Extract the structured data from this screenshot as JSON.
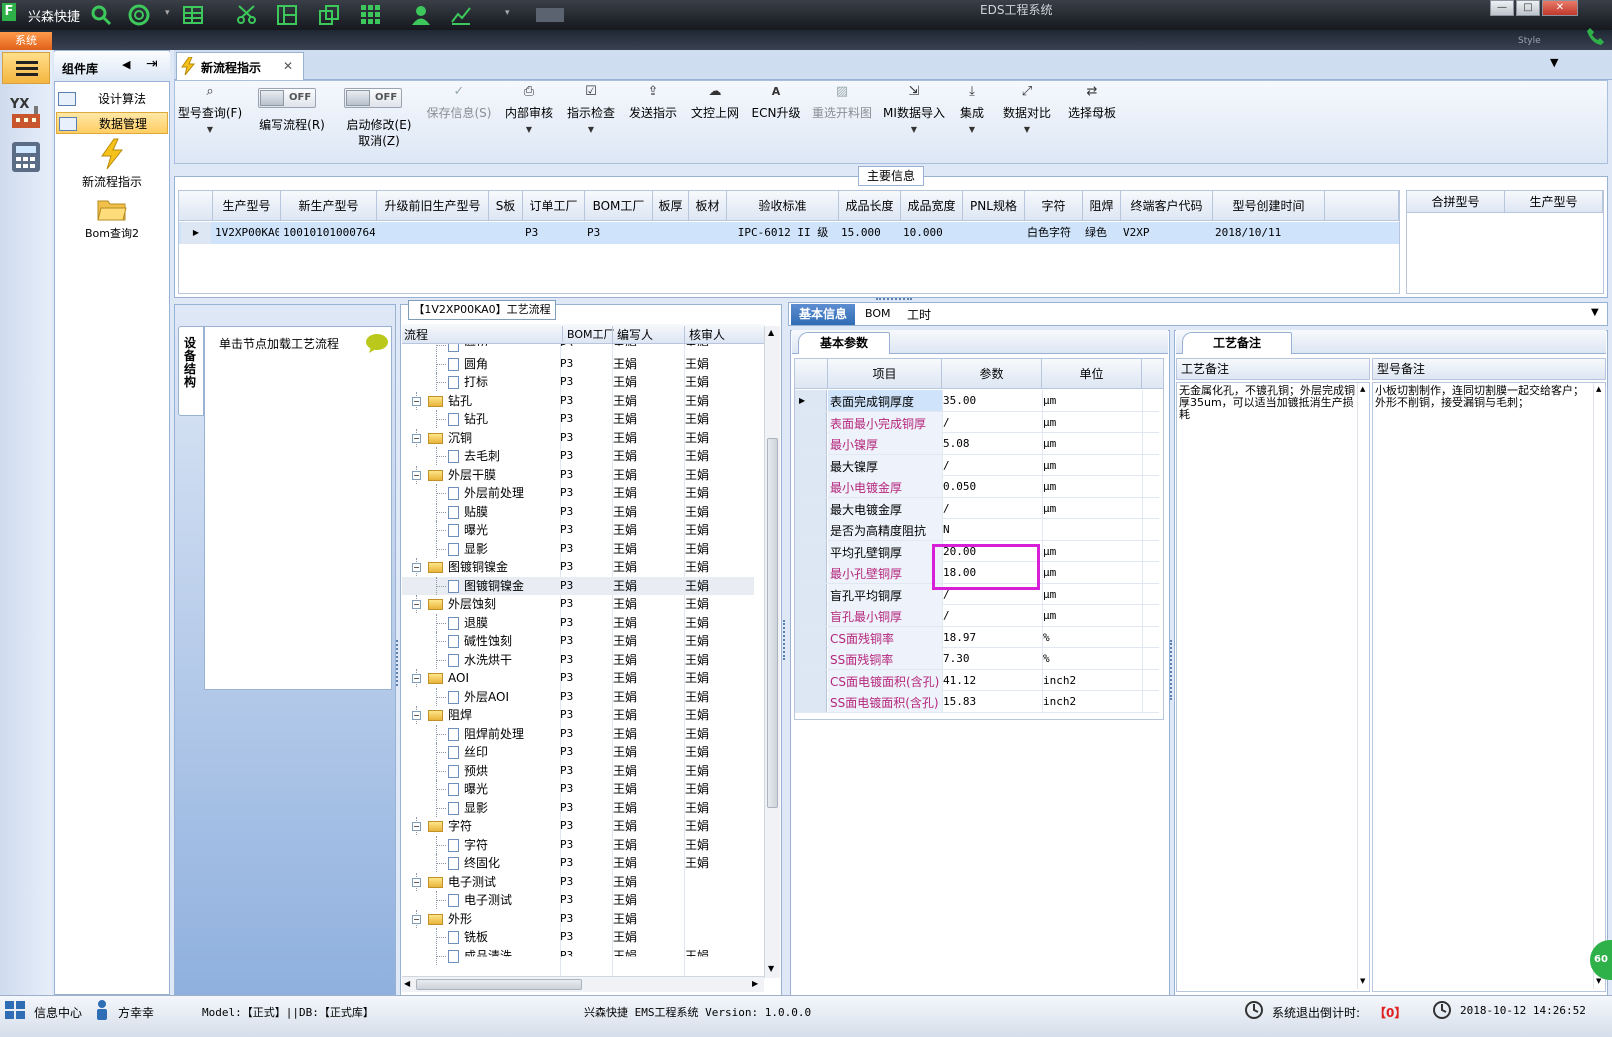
{
  "titlebar": {
    "app_name": "兴森快捷",
    "window_title": "EDS工程系统",
    "icons": [
      "search-icon",
      "lifebuoy-icon",
      "grid-icon",
      "scissors-icon",
      "layout-icon",
      "copy-icon",
      "apps-icon",
      "user-icon",
      "chart-icon"
    ]
  },
  "system_tab": "系统",
  "style_label": "Style",
  "component_panel": {
    "title": "组件库",
    "items": [
      {
        "label": "设计算法"
      },
      {
        "label": "数据管理"
      }
    ],
    "big_items": [
      {
        "label": "新流程指示",
        "icon": "lightning-icon"
      },
      {
        "label": "Bom查询2",
        "icon": "folder-icon"
      }
    ]
  },
  "document_tab": {
    "title": "新流程指示"
  },
  "ribbon": {
    "buttons": [
      {
        "label": "型号查询(F)",
        "icon": "search-icon",
        "dropdown": true
      },
      {
        "label": "保存信息(S)",
        "icon": "check-icon",
        "disabled": true
      },
      {
        "label": "内部审核",
        "icon": "print-icon",
        "dropdown": true
      },
      {
        "label": "指示检查",
        "icon": "checkbox-icon",
        "dropdown": true
      },
      {
        "label": "发送指示",
        "icon": "upload-icon"
      },
      {
        "label": "文控上网",
        "icon": "cloud-icon"
      },
      {
        "label": "ECN升级",
        "icon": "ecn-icon"
      },
      {
        "label": "重选开料图",
        "icon": "image-icon",
        "disabled": true
      },
      {
        "label": "MI数据导入",
        "icon": "import-icon",
        "dropdown": true
      },
      {
        "label": "集成",
        "icon": "download-icon",
        "dropdown": true
      },
      {
        "label": "数据对比",
        "icon": "compare-icon",
        "dropdown": true
      },
      {
        "label": "选择母板",
        "icon": "shuffle-icon"
      }
    ],
    "toggles": [
      {
        "label": "编写流程(R)",
        "state": "OFF"
      },
      {
        "label": "启动修改(E)",
        "sub_label": "取消(Z)",
        "state": "OFF"
      }
    ]
  },
  "main_info": {
    "title": "主要信息",
    "columns": [
      "生产型号",
      "新生产型号",
      "升级前旧生产型号",
      "S板",
      "订单工厂",
      "BOM工厂",
      "板厚",
      "板材",
      "验收标准",
      "成品长度",
      "成品宽度",
      "PNL规格",
      "字符",
      "阻焊",
      "终端客户代码",
      "型号创建时间"
    ],
    "row": [
      "1V2XP00KA0",
      "10010101000764",
      "",
      "",
      "P3",
      "P3",
      "",
      "",
      "IPC-6012 II 级",
      "15.000",
      "10.000",
      "",
      "白色字符",
      "绿色",
      "V2XP",
      "2018/10/11"
    ],
    "merge_columns": [
      "合拼型号",
      "生产型号"
    ]
  },
  "device_tab": "设备结构",
  "node_hint": "单击节点加载工艺流程",
  "process_panel": {
    "title": "【1V2XP00KA0】工艺流程",
    "columns": [
      "流程",
      "BOM工厂",
      "编写人",
      "核审人"
    ],
    "rows": [
      {
        "level": 2,
        "name": "磨边",
        "bom": "P3",
        "writer": "王娟",
        "checker": "王娟",
        "partial": true
      },
      {
        "level": 2,
        "name": "圆角",
        "bom": "P3",
        "writer": "王娟",
        "checker": "王娟"
      },
      {
        "level": 2,
        "name": "打标",
        "bom": "P3",
        "writer": "王娟",
        "checker": "王娟"
      },
      {
        "level": 1,
        "name": "钻孔",
        "bom": "P3",
        "writer": "王娟",
        "checker": "王娟"
      },
      {
        "level": 2,
        "name": "钻孔",
        "bom": "P3",
        "writer": "王娟",
        "checker": "王娟"
      },
      {
        "level": 1,
        "name": "沉铜",
        "bom": "P3",
        "writer": "王娟",
        "checker": "王娟"
      },
      {
        "level": 2,
        "name": "去毛刺",
        "bom": "P3",
        "writer": "王娟",
        "checker": "王娟"
      },
      {
        "level": 1,
        "name": "外层干膜",
        "bom": "P3",
        "writer": "王娟",
        "checker": "王娟"
      },
      {
        "level": 2,
        "name": "外层前处理",
        "bom": "P3",
        "writer": "王娟",
        "checker": "王娟"
      },
      {
        "level": 2,
        "name": "贴膜",
        "bom": "P3",
        "writer": "王娟",
        "checker": "王娟"
      },
      {
        "level": 2,
        "name": "曝光",
        "bom": "P3",
        "writer": "王娟",
        "checker": "王娟"
      },
      {
        "level": 2,
        "name": "显影",
        "bom": "P3",
        "writer": "王娟",
        "checker": "王娟"
      },
      {
        "level": 1,
        "name": "图镀铜镍金",
        "bom": "P3",
        "writer": "王娟",
        "checker": "王娟"
      },
      {
        "level": 2,
        "name": "图镀铜镍金",
        "bom": "P3",
        "writer": "王娟",
        "checker": "王娟",
        "selected": true
      },
      {
        "level": 1,
        "name": "外层蚀刻",
        "bom": "P3",
        "writer": "王娟",
        "checker": "王娟"
      },
      {
        "level": 2,
        "name": "退膜",
        "bom": "P3",
        "writer": "王娟",
        "checker": "王娟"
      },
      {
        "level": 2,
        "name": "碱性蚀刻",
        "bom": "P3",
        "writer": "王娟",
        "checker": "王娟"
      },
      {
        "level": 2,
        "name": "水洗烘干",
        "bom": "P3",
        "writer": "王娟",
        "checker": "王娟"
      },
      {
        "level": 1,
        "name": "AOI",
        "bom": "P3",
        "writer": "王娟",
        "checker": "王娟"
      },
      {
        "level": 2,
        "name": "外层AOI",
        "bom": "P3",
        "writer": "王娟",
        "checker": "王娟"
      },
      {
        "level": 1,
        "name": "阻焊",
        "bom": "P3",
        "writer": "王娟",
        "checker": "王娟"
      },
      {
        "level": 2,
        "name": "阻焊前处理",
        "bom": "P3",
        "writer": "王娟",
        "checker": "王娟"
      },
      {
        "level": 2,
        "name": "丝印",
        "bom": "P3",
        "writer": "王娟",
        "checker": "王娟"
      },
      {
        "level": 2,
        "name": "预烘",
        "bom": "P3",
        "writer": "王娟",
        "checker": "王娟"
      },
      {
        "level": 2,
        "name": "曝光",
        "bom": "P3",
        "writer": "王娟",
        "checker": "王娟"
      },
      {
        "level": 2,
        "name": "显影",
        "bom": "P3",
        "writer": "王娟",
        "checker": "王娟"
      },
      {
        "level": 1,
        "name": "字符",
        "bom": "P3",
        "writer": "王娟",
        "checker": "王娟"
      },
      {
        "level": 2,
        "name": "字符",
        "bom": "P3",
        "writer": "王娟",
        "checker": "王娟"
      },
      {
        "level": 2,
        "name": "终固化",
        "bom": "P3",
        "writer": "王娟",
        "checker": "王娟"
      },
      {
        "level": 1,
        "name": "电子测试",
        "bom": "P3",
        "writer": "王娟",
        "checker": ""
      },
      {
        "level": 2,
        "name": "电子测试",
        "bom": "P3",
        "writer": "王娟",
        "checker": ""
      },
      {
        "level": 1,
        "name": "外形",
        "bom": "P3",
        "writer": "王娟",
        "checker": ""
      },
      {
        "level": 2,
        "name": "铣板",
        "bom": "P3",
        "writer": "王娟",
        "checker": ""
      },
      {
        "level": 2,
        "name": "成品清洗",
        "bom": "P3",
        "writer": "王娟",
        "checker": "王娟",
        "partial": true
      }
    ]
  },
  "right_tabs": [
    "基本信息",
    "BOM",
    "工时"
  ],
  "params_panel": {
    "title": "基本参数",
    "columns": [
      "项目",
      "参数",
      "单位"
    ],
    "rows": [
      {
        "item": "表面完成铜厚度",
        "value": "35.00",
        "unit": "μm",
        "required": false,
        "current": true
      },
      {
        "item": "表面最小完成铜厚",
        "value": "/",
        "unit": "μm",
        "required": true
      },
      {
        "item": "最小镍厚",
        "value": "5.08",
        "unit": "μm",
        "required": true
      },
      {
        "item": "最大镍厚",
        "value": "/",
        "unit": "μm",
        "required": false
      },
      {
        "item": "最小电镀金厚",
        "value": "0.050",
        "unit": "μm",
        "required": true
      },
      {
        "item": "最大电镀金厚",
        "value": "/",
        "unit": "μm",
        "required": false
      },
      {
        "item": "是否为高精度阻抗",
        "value": "N",
        "unit": "",
        "required": false
      },
      {
        "item": "平均孔壁铜厚",
        "value": "20.00",
        "unit": "μm",
        "required": false
      },
      {
        "item": "最小孔壁铜厚",
        "value": "18.00",
        "unit": "μm",
        "required": true
      },
      {
        "item": "盲孔平均铜厚",
        "value": "/",
        "unit": "μm",
        "required": false
      },
      {
        "item": "盲孔最小铜厚",
        "value": "/",
        "unit": "μm",
        "required": true
      },
      {
        "item": "CS面残铜率",
        "value": "18.97",
        "unit": "%",
        "required": true
      },
      {
        "item": "SS面残铜率",
        "value": "7.30",
        "unit": "%",
        "required": true
      },
      {
        "item": "CS面电镀面积(含孔)",
        "value": "41.12",
        "unit": "inch2",
        "required": true
      },
      {
        "item": "SS面电镀面积(含孔)",
        "value": "15.83",
        "unit": "inch2",
        "required": true
      }
    ],
    "highlight_color": "#d61fd6"
  },
  "notes_panel": {
    "title": "工艺备注",
    "process_note_label": "工艺备注",
    "model_note_label": "型号备注",
    "process_note": "无金属化孔，不镀孔铜；外层完成铜厚35um，可以适当加镀抵消生产损耗",
    "model_note": "小板切割制作，连同切割膜一起交给客户；\n外形不削铜，接受漏铜与毛刺；"
  },
  "badge": "60",
  "statusbar": {
    "info_center": "信息中心",
    "user": "方幸幸",
    "model_db": "Model:【正式】||DB:【正式库】",
    "app_version": "兴森快捷 EMS工程系统 Version: 1.0.0.0",
    "exit_countdown_label": "系统退出倒计时:",
    "exit_countdown_value": "【0】",
    "datetime": "2018-10-12 14:26:52"
  },
  "colors": {
    "accent": "#2f6db5",
    "required_text": "#b5267c",
    "selected_row": "#cfe3fb",
    "title_bg": "#1c2026",
    "status_red": "#e02020"
  }
}
